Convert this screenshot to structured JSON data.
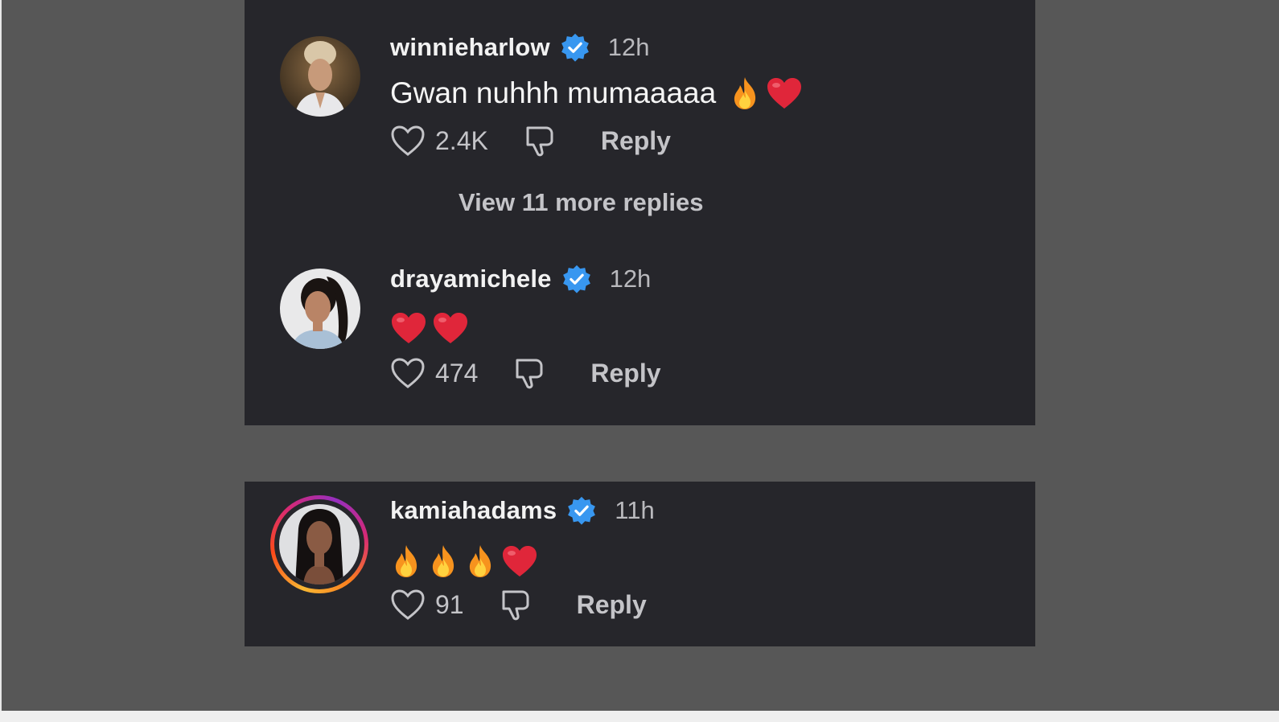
{
  "comments_top": [
    {
      "username": "winnieharlow",
      "time": "12h",
      "text": "Gwan nuhhh mumaaaaa",
      "emojis": [
        "fire",
        "heart"
      ],
      "likes": "2.4K",
      "reply_label": "Reply",
      "avatar_ring": false
    },
    {
      "username": "drayamichele",
      "time": "12h",
      "text": "",
      "emojis": [
        "heart",
        "heart"
      ],
      "likes": "474",
      "reply_label": "Reply",
      "avatar_ring": false
    }
  ],
  "view_more_label": "View 11 more replies",
  "comments_bottom": [
    {
      "username": "kamiahadams",
      "time": "11h",
      "text": "",
      "emojis": [
        "fire",
        "fire",
        "fire",
        "heart"
      ],
      "likes": "91",
      "reply_label": "Reply",
      "avatar_ring": true
    }
  ],
  "colors": {
    "panel": "#26262b",
    "background": "#575757",
    "verified": "#3897f0",
    "text_primary": "#f2f2f2",
    "text_secondary": "#c4c4c8"
  }
}
